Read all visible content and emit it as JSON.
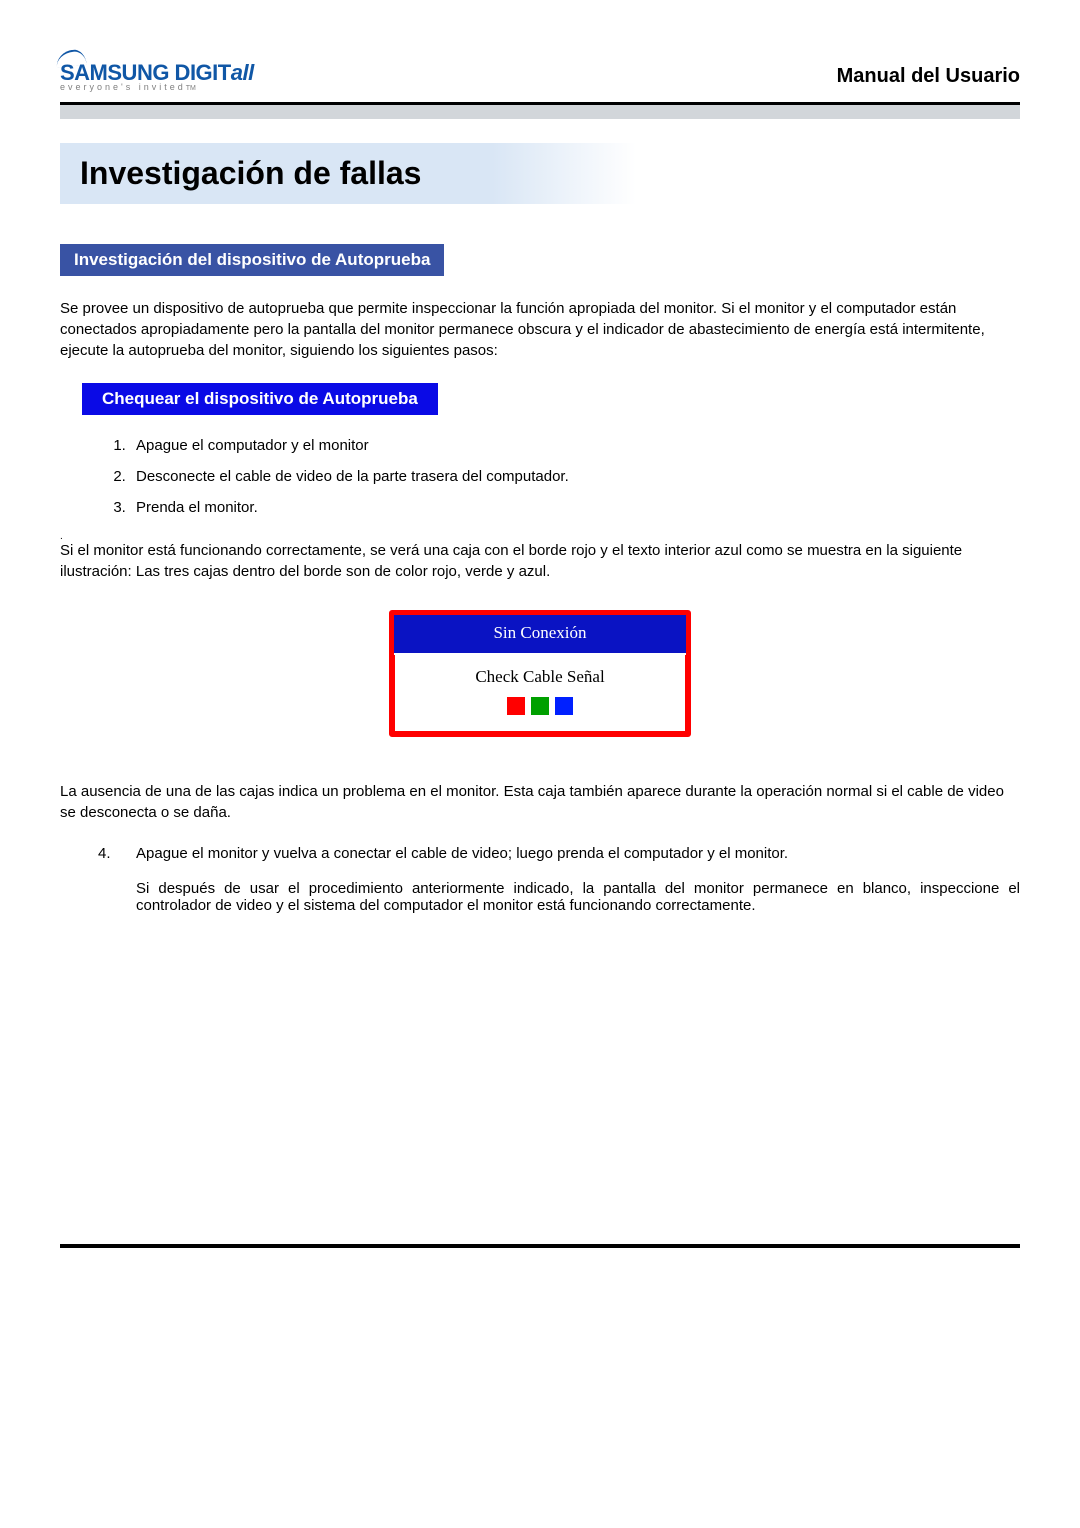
{
  "header": {
    "logo_brand": "SAMSUNG DIGIT",
    "logo_brand_italic": "all",
    "logo_tagline": "everyone's invited",
    "logo_tagline_tm": "TM",
    "manual_title": "Manual del Usuario"
  },
  "page_title": "Investigación de fallas",
  "section_a_title": "Investigación del dispositivo de Autoprueba",
  "intro_text": "Se provee un dispositivo de autoprueba que permite inspeccionar la función apropiada del monitor. Si el monitor y el computador están conectados apropiadamente pero la pantalla del monitor permanece obscura y el indicador de abastecimiento de energía está intermitente, ejecute la autoprueba del monitor, siguiendo los siguientes pasos:",
  "section_b_title": "Chequear el dispositivo de Autoprueba",
  "steps": {
    "s1": "Apague el computador y el monitor",
    "s2": "Desconecte el cable de video de la parte trasera del computador.",
    "s3": "Prenda el monitor."
  },
  "dot": ".",
  "para_after_steps": "Si el monitor está funcionando correctamente, se verá una caja con el borde rojo y el texto interior azul como se muestra en la siguiente ilustración: Las tres cajas dentro del borde son de color rojo, verde y azul.",
  "illustration": {
    "top": "Sin Conexión",
    "mid": "Check Cable Señal"
  },
  "para_after_illustration": "La ausencia de una de las cajas indica un problema en el monitor. Esta caja también aparece durante la operación normal si el cable de video se desconecta o se daña.",
  "step4": "Apague el monitor y vuelva a conectar el cable de video; luego prenda el computador y el monitor.",
  "step4_sub": "Si después de usar el procedimiento anteriormente indicado, la pantalla del monitor permanece en blanco, inspeccione el controlador de video y el sistema del computador el monitor está funcionando correctamente."
}
